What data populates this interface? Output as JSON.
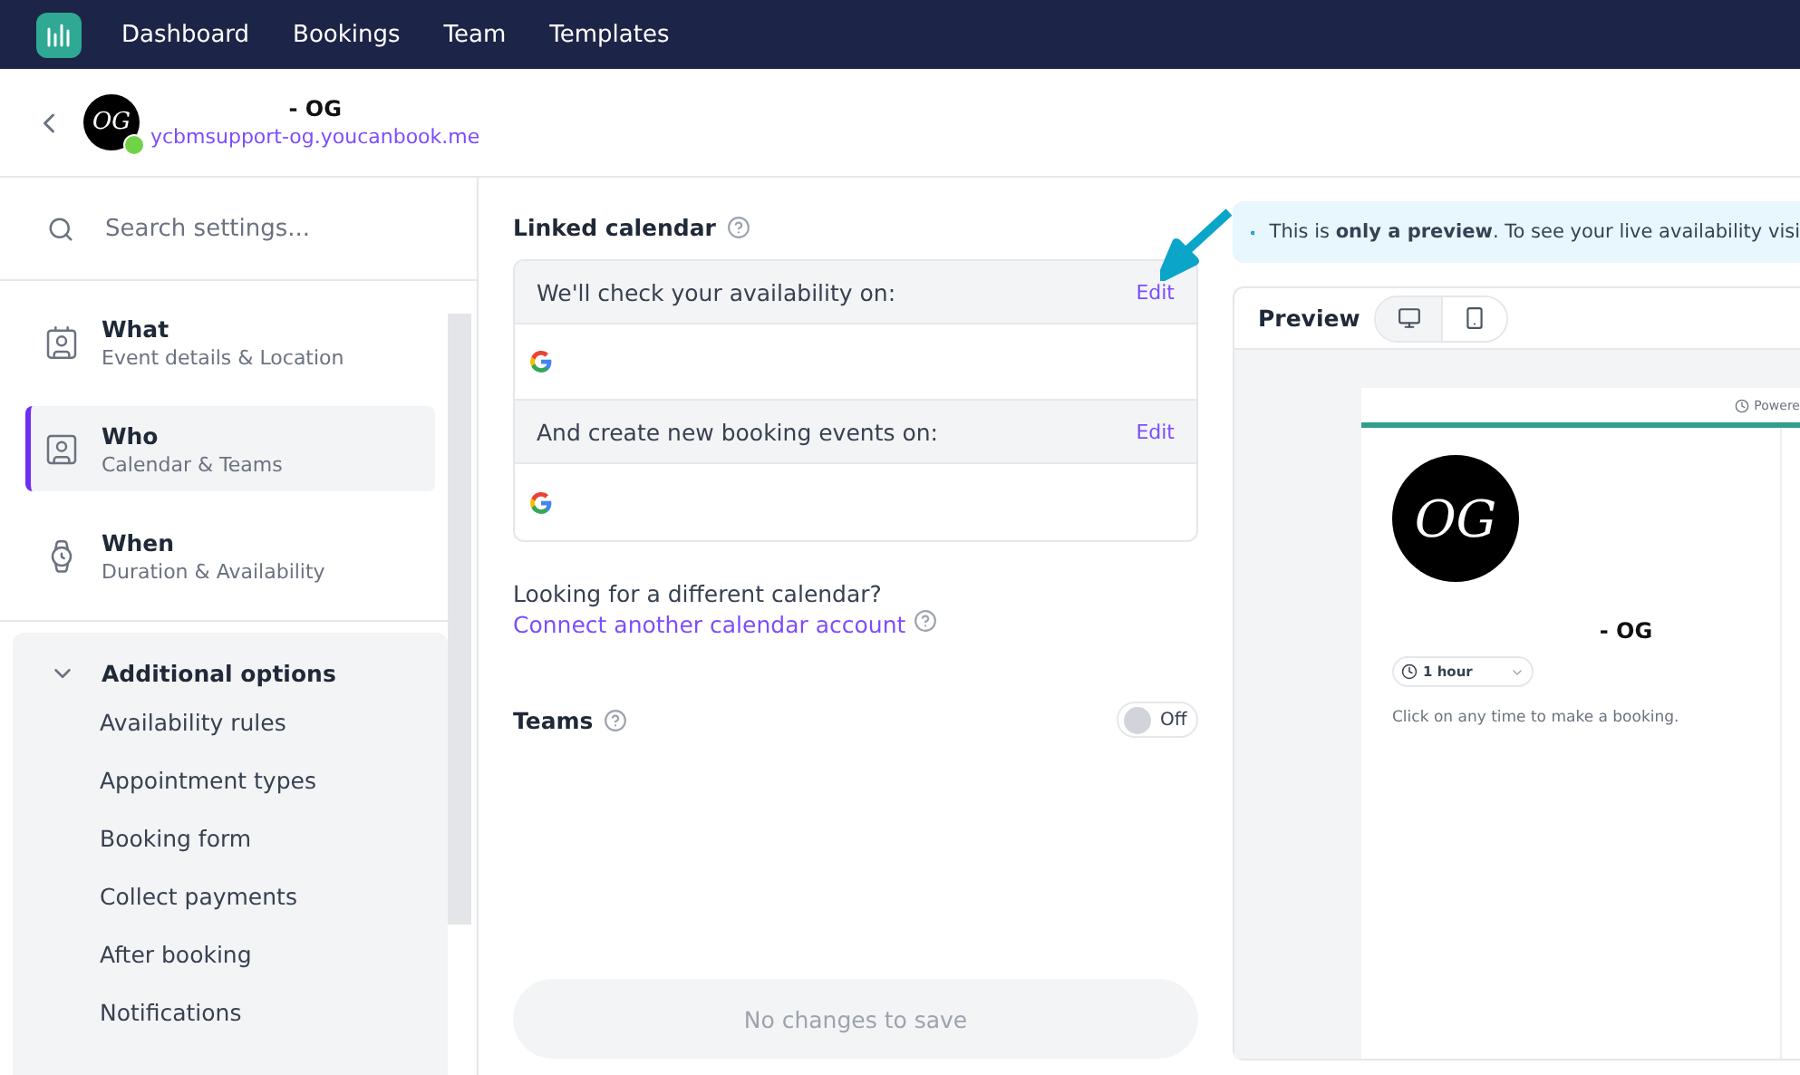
{
  "nav": {
    "items": [
      {
        "label": "Dashboard"
      },
      {
        "label": "Bookings"
      },
      {
        "label": "Team"
      },
      {
        "label": "Templates"
      }
    ]
  },
  "header": {
    "title": "- OG",
    "avatar_initials": "OG",
    "link": "ycbmsupport-og.youcanbook.me",
    "online": true
  },
  "sidebar": {
    "search": {
      "placeholder": "Search settings..."
    },
    "sections": [
      {
        "title": "What",
        "subtitle": "Event details & Location",
        "kind": "card",
        "selected": false
      },
      {
        "title": "Who",
        "subtitle": "Calendar & Teams",
        "kind": "people",
        "selected": true
      },
      {
        "title": "When",
        "subtitle": "Duration & Availability",
        "kind": "watch",
        "selected": false
      }
    ],
    "additional": {
      "title": "Additional options",
      "expanded": true,
      "items": [
        "Availability rules",
        "Appointment types",
        "Booking form",
        "Collect payments",
        "After booking",
        "Notifications"
      ]
    }
  },
  "linked_calendar": {
    "title": "Linked calendar",
    "rows": [
      {
        "label": "We'll check your availability on:",
        "action": "Edit"
      },
      {
        "label": "And create new booking events on:",
        "action": "Edit"
      }
    ],
    "note": "Looking for a different calendar?",
    "link": "Connect another calendar account"
  },
  "teams": {
    "title": "Teams",
    "on": false,
    "state_label": "Off"
  },
  "save_button": {
    "label": "No changes to save",
    "disabled": true
  },
  "preview": {
    "notice": "This is **only a preview**. To see your live availability visi",
    "title": "Preview",
    "devices": [
      {
        "kind": "desktop",
        "selected": true
      },
      {
        "kind": "mobile",
        "selected": false
      }
    ],
    "page": {
      "powered": "Powere",
      "avatar_initials": "OG",
      "name": "- OG",
      "duration": "1 hour",
      "hint": "Click on any time to make a booking."
    }
  }
}
